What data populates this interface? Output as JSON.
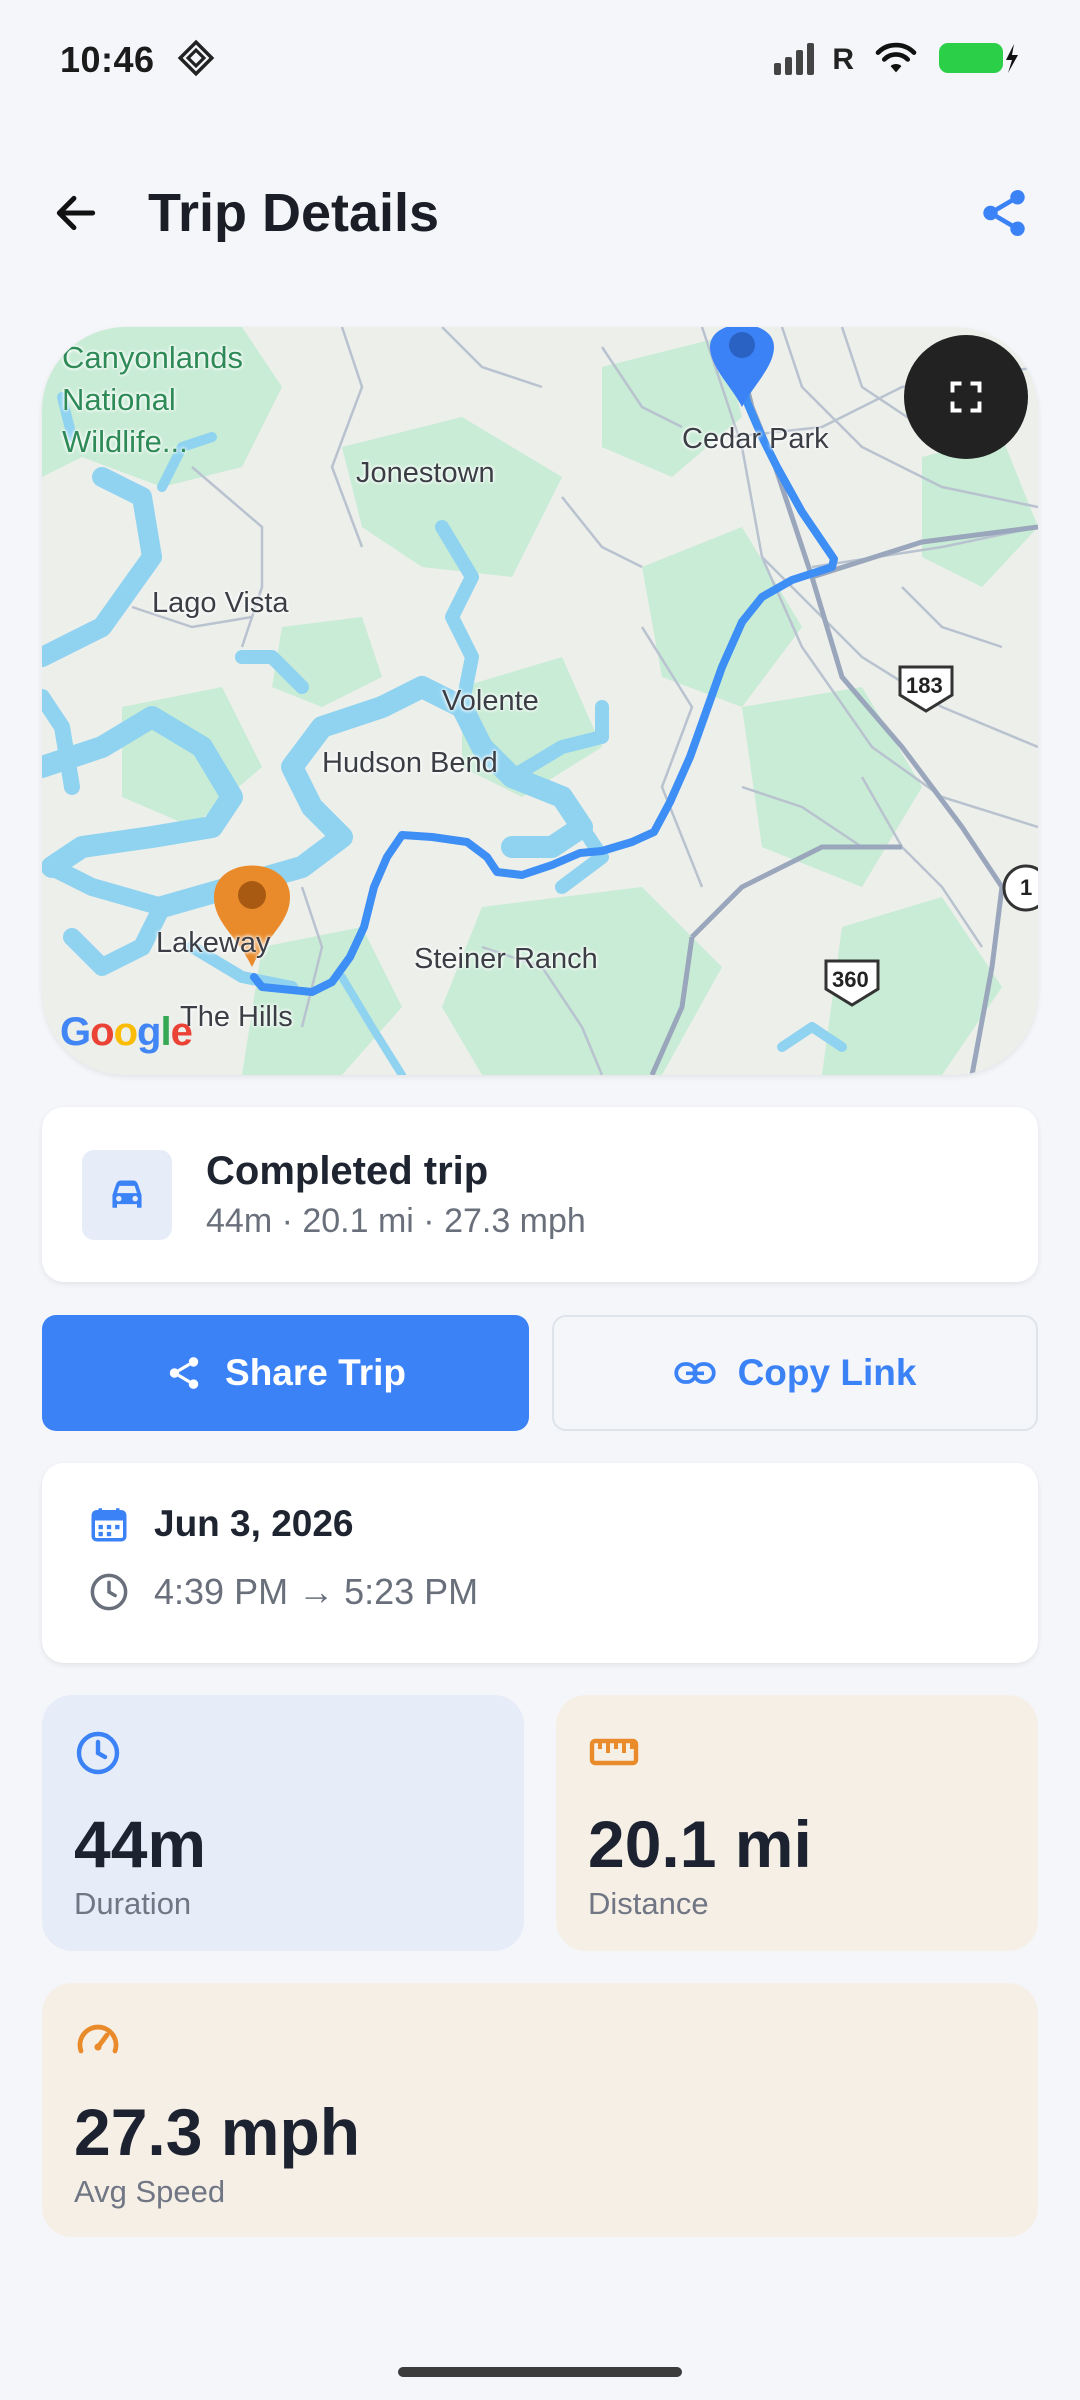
{
  "status_bar": {
    "time": "10:46",
    "signal_suffix": "R"
  },
  "header": {
    "title": "Trip Details"
  },
  "map": {
    "labels": {
      "park": "Canyonlands\nNational\nWildlife...",
      "jonestown": "Jonestown",
      "cedar_park": "Cedar Park",
      "lago_vista": "Lago Vista",
      "volente": "Volente",
      "hudson_bend": "Hudson Bend",
      "lakeway": "Lakeway",
      "steiner_ranch": "Steiner Ranch",
      "the_hills": "The Hills",
      "hwy_183": "183",
      "hwy_360": "360",
      "hwy_1": "1"
    },
    "google": "Google"
  },
  "trip": {
    "title": "Completed trip",
    "summary": "44m · 20.1 mi · 27.3 mph"
  },
  "actions": {
    "share": "Share Trip",
    "copy": "Copy Link"
  },
  "date": {
    "day": "Jun 3, 2026",
    "range": "4:39 PM → 5:23 PM"
  },
  "stats": {
    "duration": {
      "value": "44m",
      "label": "Duration"
    },
    "distance": {
      "value": "20.1 mi",
      "label": "Distance"
    },
    "speed": {
      "value": "27.3 mph",
      "label": "Avg Speed"
    }
  },
  "colors": {
    "accent": "#3b82f6",
    "route": "#3d8ef5",
    "start_pin": "#e98b2b",
    "end_pin": "#3b82f6",
    "water": "#8fd3f0",
    "park": "#c8ecd5"
  }
}
